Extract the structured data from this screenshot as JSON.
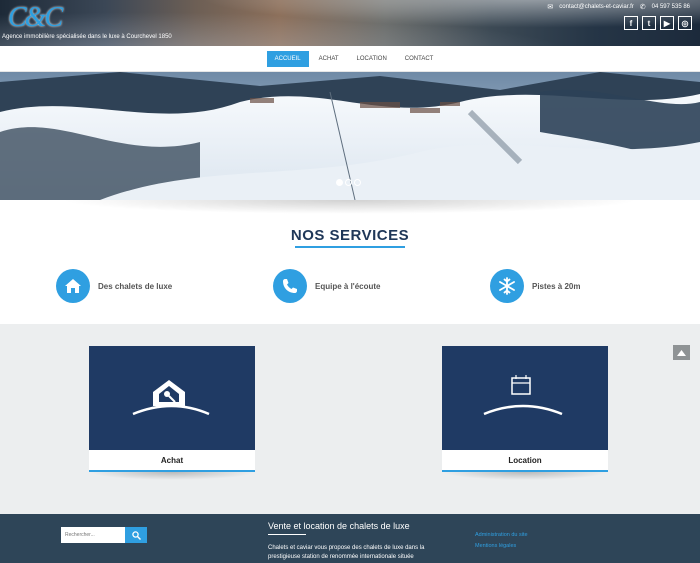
{
  "header": {
    "logo": "C&C",
    "tagline": "Agence immobilière spécialisée dans le luxe à Courchevel 1850",
    "email": "contact@chalets-et-caviar.fr",
    "phone": "04 597 535 86",
    "socials": [
      {
        "name": "facebook-icon",
        "glyph": "f"
      },
      {
        "name": "twitter-icon",
        "glyph": "t"
      },
      {
        "name": "youtube-icon",
        "glyph": "▶"
      },
      {
        "name": "instagram-icon",
        "glyph": "◎"
      }
    ]
  },
  "nav": {
    "items": [
      "ACCUEIL",
      "ACHAT",
      "LOCATION",
      "CONTACT"
    ],
    "active": "ACCUEIL"
  },
  "slider": {
    "slides": 3,
    "active_slide": 1
  },
  "services": {
    "title": "NOS SERVICES",
    "items": [
      {
        "label": "Des chalets de luxe",
        "icon": "home-icon"
      },
      {
        "label": "Equipe à l'écoute",
        "icon": "phone-icon"
      },
      {
        "label": "Pistes à 20m",
        "icon": "snowflake-icon"
      }
    ]
  },
  "cards": [
    {
      "label": "Achat",
      "icon": "house-key-icon"
    },
    {
      "label": "Location",
      "icon": "calendar-icon"
    }
  ],
  "footer": {
    "search_placeholder": "Rechercher...",
    "title": "Vente et location de chalets de luxe",
    "text": "Chalets et caviar vous propose des chalets de luxe dans la prestigieuse station de renommée internationale située",
    "links": [
      "Administration du site",
      "Mentions légales"
    ]
  },
  "colors": {
    "accent": "#2f9fe1",
    "navy": "#1f3a64",
    "footer": "#2e4558"
  }
}
